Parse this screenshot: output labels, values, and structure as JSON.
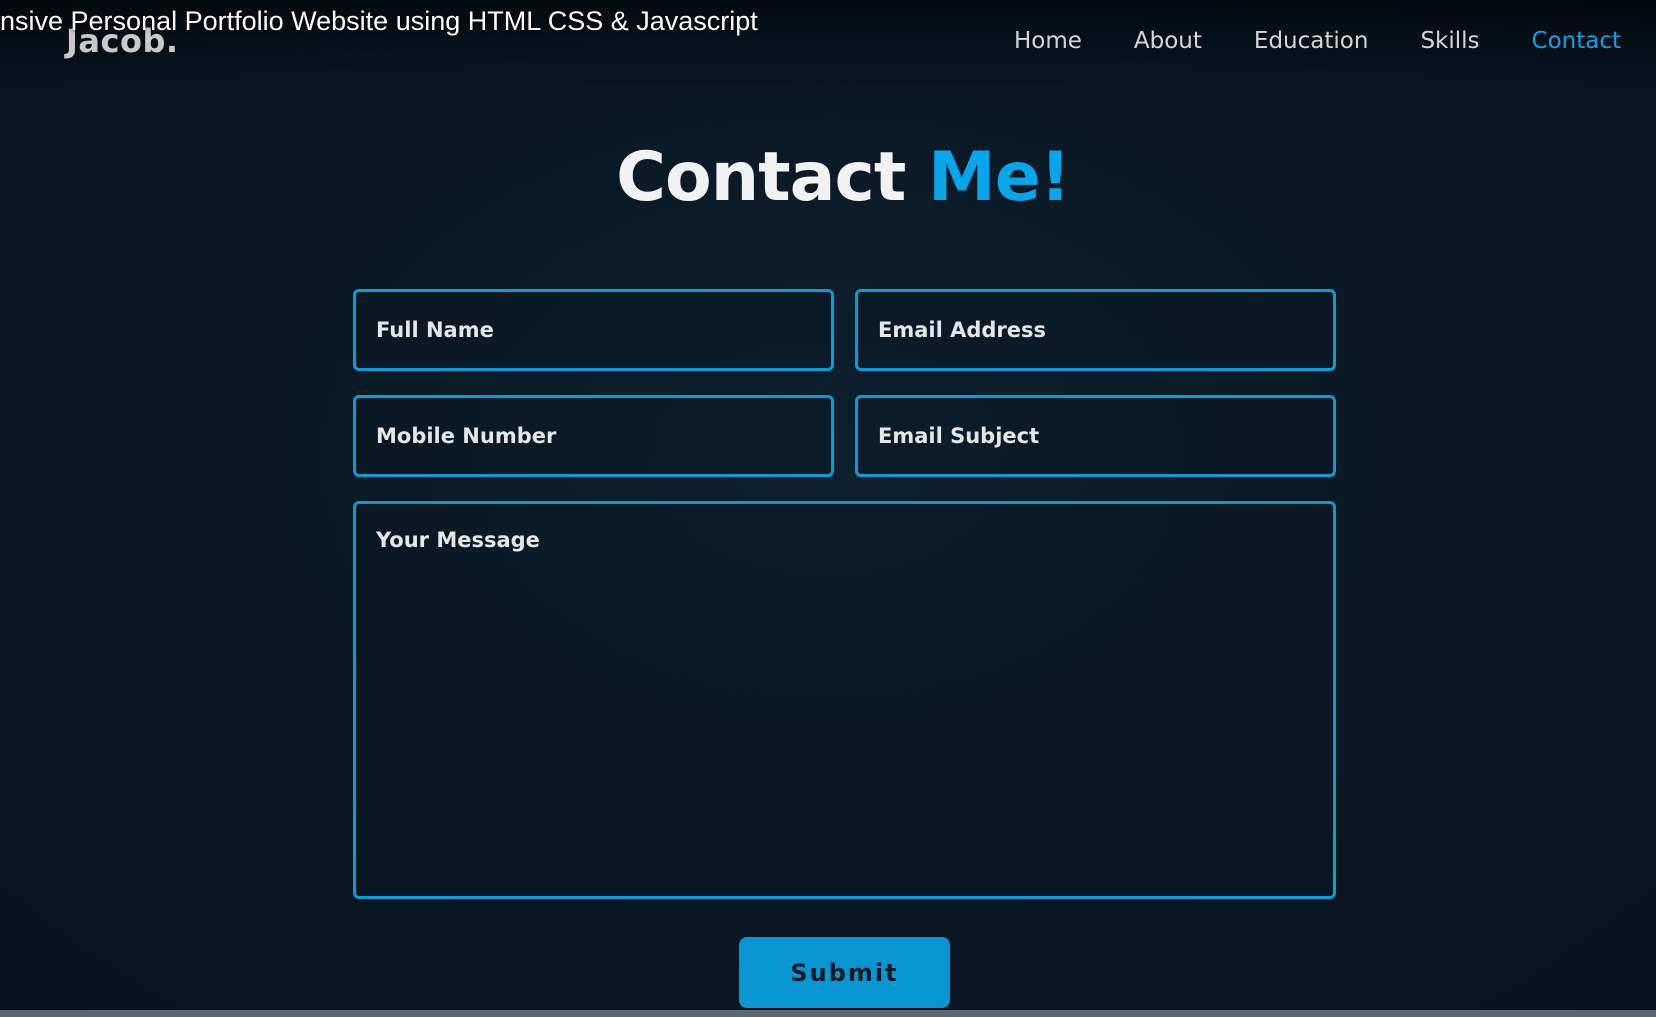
{
  "video": {
    "title": "nsive Personal Portfolio Website using HTML CSS & Javascript"
  },
  "header": {
    "logo": "Jacob.",
    "nav": [
      {
        "label": "Home",
        "active": false
      },
      {
        "label": "About",
        "active": false
      },
      {
        "label": "Education",
        "active": false
      },
      {
        "label": "Skills",
        "active": false
      },
      {
        "label": "Contact",
        "active": true
      }
    ]
  },
  "contact": {
    "heading_main": "Contact ",
    "heading_accent": "Me!",
    "fields": {
      "full_name": {
        "placeholder": "Full Name",
        "value": ""
      },
      "email_address": {
        "placeholder": "Email Address",
        "value": ""
      },
      "mobile_number": {
        "placeholder": "Mobile Number",
        "value": ""
      },
      "email_subject": {
        "placeholder": "Email Subject",
        "value": ""
      },
      "message": {
        "placeholder": "Your Message",
        "value": ""
      }
    },
    "submit_label": "Submit"
  },
  "colors": {
    "accent": "#0aa4e8",
    "background": "#0a1926",
    "field_border": "#0f9ad6",
    "button_bg": "#0896d2"
  }
}
